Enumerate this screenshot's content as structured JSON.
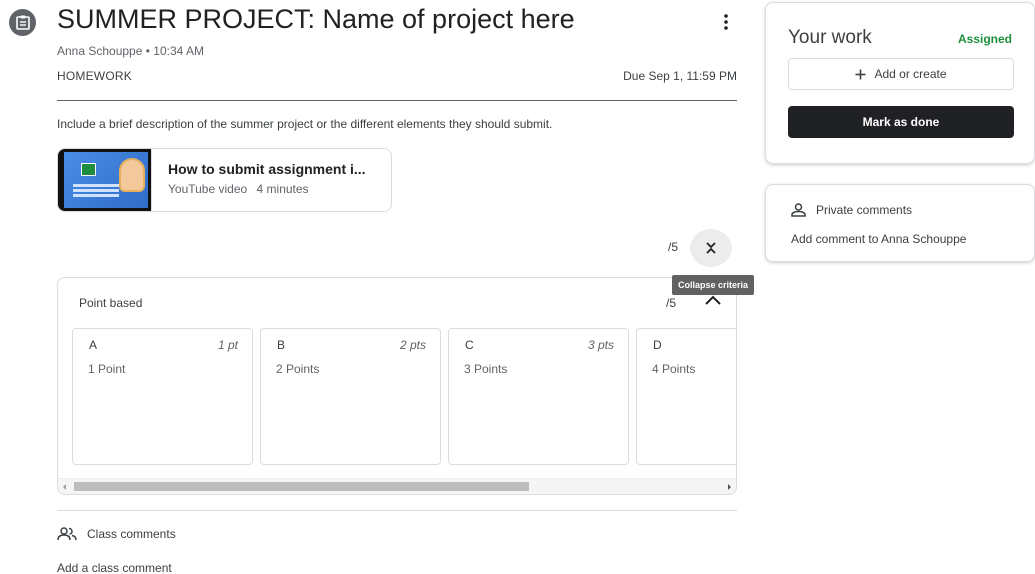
{
  "assignment": {
    "title": "SUMMER PROJECT: Name of project here",
    "byline": "Anna Schouppe • 10:34 AM",
    "category": "HOMEWORK",
    "due": "Due Sep 1, 11:59 PM",
    "description": "Include a brief description of the summer project or the different elements they should submit."
  },
  "icons": {
    "assignment": "assignment-icon",
    "more": "more-vert-icon",
    "collapse": "collapse-all-icon",
    "expand_less": "chevron-up-icon",
    "add": "plus-icon",
    "person": "person-icon",
    "people": "people-icon"
  },
  "attachment": {
    "title": "How to submit assignment i...",
    "type": "YouTube video",
    "duration": "4 minutes"
  },
  "grading": {
    "total": "/5",
    "tooltip": "Collapse criteria"
  },
  "rubric": {
    "criterion": "Point based",
    "score": "/5",
    "levels": [
      {
        "name": "A",
        "points": "1 pt",
        "description": "1 Point"
      },
      {
        "name": "B",
        "points": "2 pts",
        "description": "2 Points"
      },
      {
        "name": "C",
        "points": "3 pts",
        "description": "3 Points"
      },
      {
        "name": "D",
        "points": "",
        "description": "4 Points"
      }
    ]
  },
  "class_comments": {
    "label": "Class comments",
    "add": "Add a class comment"
  },
  "your_work": {
    "title": "Your work",
    "status": "Assigned",
    "add_create": "Add or create",
    "mark_done": "Mark as done"
  },
  "private_comments": {
    "label": "Private comments",
    "add": "Add comment to Anna Schouppe"
  },
  "colors": {
    "accent_green": "#1e8e3e",
    "primary_dark": "#202124",
    "tooltip": "#616161"
  }
}
